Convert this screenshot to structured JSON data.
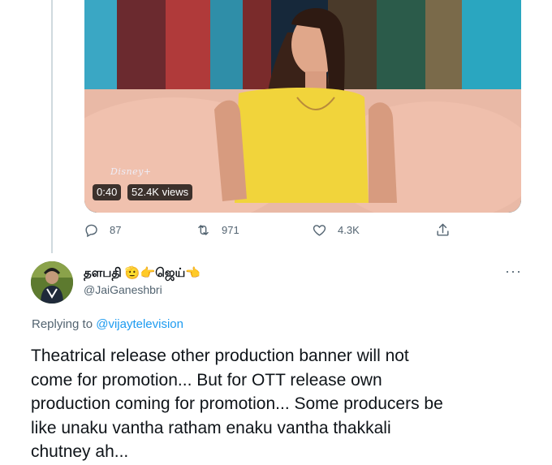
{
  "video": {
    "watermark": "Disney+",
    "duration": "0:40",
    "views": "52.4K views"
  },
  "actions": {
    "replies": "87",
    "retweets": "971",
    "likes": "4.3K"
  },
  "reply": {
    "display_name": "தளபதி 🫡👉ஜெய்👈",
    "handle": "@JaiGaneshbri",
    "more_label": "···",
    "replying_prefix": "Replying to ",
    "replying_to": "@vijaytelevision",
    "text": "Theatrical release other production banner will not\ncome for promotion... But for OTT release own\nproduction coming for promotion... Some producers be\nlike unaku vantha ratham enaku vantha thakkali\nchutney ah..."
  },
  "colors": {
    "accent": "#1d9bf0",
    "muted": "#536471",
    "text": "#0f1419"
  }
}
